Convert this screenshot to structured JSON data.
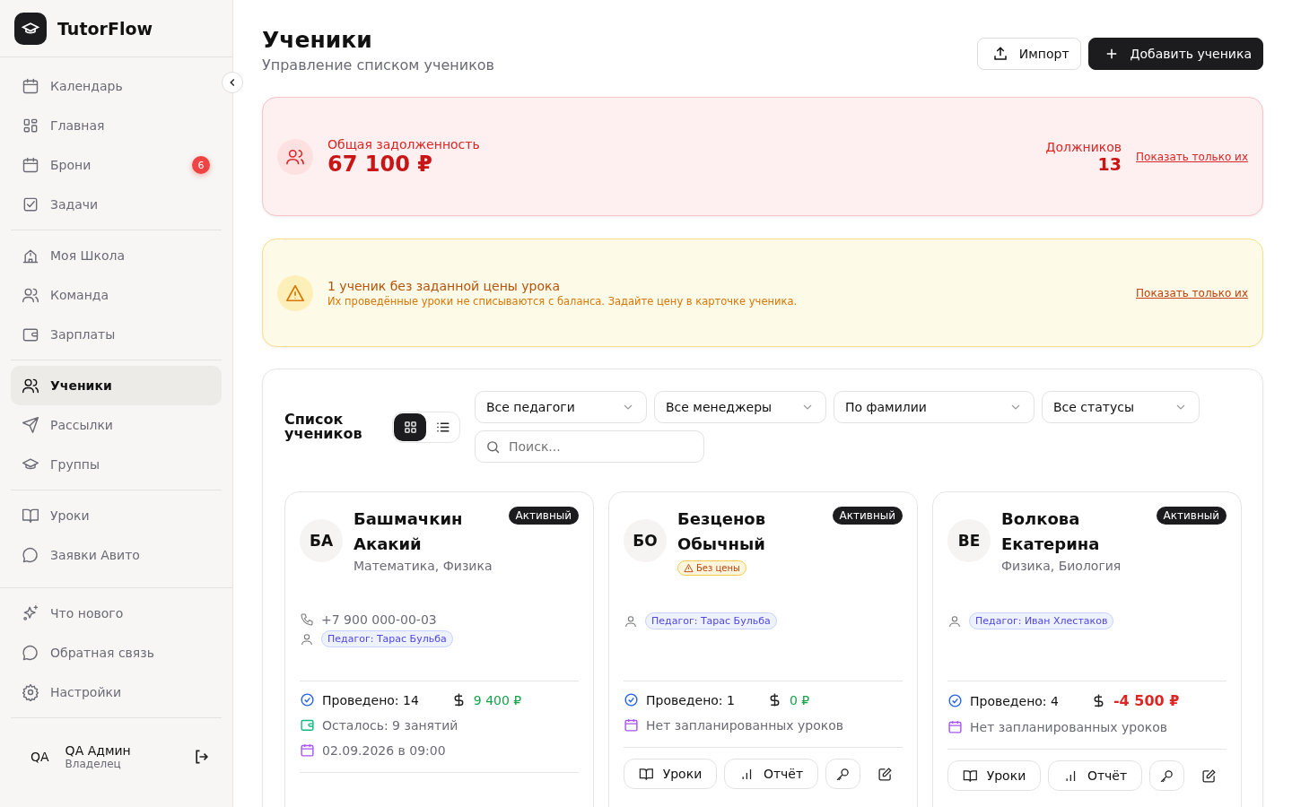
{
  "brand": {
    "name": "TutorFlow"
  },
  "sidebar": {
    "groups": [
      {
        "items": [
          {
            "label": "Календарь",
            "selected": false
          },
          {
            "label": "Главная",
            "selected": false
          },
          {
            "label": "Брони",
            "selected": false,
            "badge": "6"
          },
          {
            "label": "Задачи",
            "selected": false
          }
        ]
      },
      {
        "items": [
          {
            "label": "Моя Школа",
            "selected": false
          },
          {
            "label": "Команда",
            "selected": false
          },
          {
            "label": "Зарплаты",
            "selected": false
          }
        ]
      },
      {
        "items": [
          {
            "label": "Ученики",
            "selected": true
          },
          {
            "label": "Рассылки",
            "selected": false
          },
          {
            "label": "Группы",
            "selected": false
          }
        ]
      },
      {
        "items": [
          {
            "label": "Уроки",
            "selected": false
          },
          {
            "label": "Заявки Авито",
            "selected": false
          }
        ]
      },
      {
        "items": [
          {
            "label": "Что нового",
            "selected": false
          },
          {
            "label": "Обратная связь",
            "selected": false
          },
          {
            "label": "Настройки",
            "selected": false
          }
        ]
      }
    ],
    "user": {
      "initials": "QA",
      "name": "QA Админ",
      "role": "Владелец"
    }
  },
  "header": {
    "title": "Ученики",
    "subtitle": "Управление списком учеников",
    "buttons": [
      {
        "label": "Импорт",
        "kind": "secondary"
      },
      {
        "label": "Добавить ученика",
        "kind": "primary"
      }
    ]
  },
  "debt_banner": {
    "label": "Общая задолженность",
    "amount": "67 100 ₽",
    "debtors_label": "Должников",
    "debtors_count": "13",
    "link": "Показать только их"
  },
  "price_banner": {
    "title": "1 ученик без заданной цены урока",
    "text": "Их проведённые уроки не списываются с баланса. Задайте цену в карточке ученика.",
    "link": "Показать только их"
  },
  "list": {
    "title": "Список учеников",
    "views": [
      {
        "kind": "grid",
        "selected": true
      },
      {
        "kind": "list",
        "selected": false
      }
    ],
    "filters": [
      "Все педагоги",
      "Все менеджеры",
      "По фамилии",
      "Все статусы"
    ],
    "search": {
      "placeholder": "Поиск..."
    },
    "students": [
      {
        "initials": "БА",
        "name": "Башмачкин Акакий",
        "status": "Активный",
        "subjects": "Математика, Физика",
        "phone": "+7 900 000-00-03",
        "teacher": "Педагог: Тарас Бульба",
        "conducted": "Проведено: 14",
        "balance": "9 400 ₽",
        "in_debt": false,
        "remaining": "Осталось: 9 занятий",
        "next_lesson": "02.09.2026 в 09:00"
      },
      {
        "initials": "БО",
        "name": "Безценов Обычный",
        "status": "Активный",
        "no_price": "Без цены",
        "teacher": "Педагог: Тарас Бульба",
        "conducted": "Проведено: 1",
        "balance": "0 ₽",
        "in_debt": false,
        "next_lesson": "Нет запланированных уроков",
        "actions": [
          {
            "kind": "lessons",
            "label": "Уроки"
          },
          {
            "kind": "report",
            "label": "Отчёт"
          },
          {
            "kind": "key"
          },
          {
            "kind": "edit"
          }
        ]
      },
      {
        "initials": "ВЕ",
        "name": "Волкова Екатерина",
        "status": "Активный",
        "subjects": "Физика, Биология",
        "teacher": "Педагог: Иван Хлестаков",
        "conducted": "Проведено: 4",
        "balance": "-4 500 ₽",
        "in_debt": true,
        "next_lesson": "Нет запланированных уроков",
        "actions": [
          {
            "kind": "lessons",
            "label": "Уроки"
          },
          {
            "kind": "report",
            "label": "Отчёт"
          },
          {
            "kind": "key"
          },
          {
            "kind": "edit"
          }
        ]
      }
    ]
  }
}
